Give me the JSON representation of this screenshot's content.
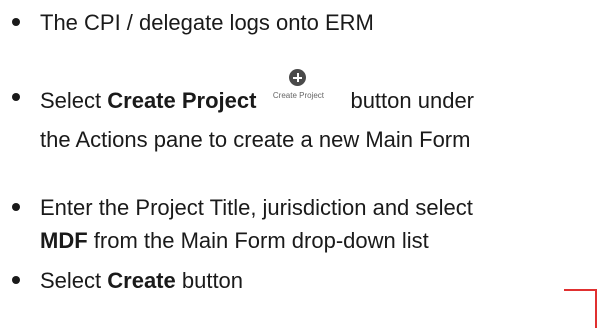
{
  "bullets": [
    {
      "text": "The CPI / delegate logs onto ERM"
    },
    {
      "line1_prefix": "Select ",
      "line1_bold": "Create Project",
      "line1_suffix": "button under",
      "line2": "the Actions pane to create a new Main Form",
      "button_caption": "Create Project",
      "button_icon": "plus-circle-icon"
    },
    {
      "line1": "Enter the Project Title, jurisdiction and select",
      "line2_bold": "MDF",
      "line2_suffix": " from the Main Form drop-down list"
    },
    {
      "prefix": "Select ",
      "bold": "Create",
      "suffix": " button"
    }
  ],
  "colors": {
    "text": "#1a1a1a",
    "connector": "#e03030"
  }
}
